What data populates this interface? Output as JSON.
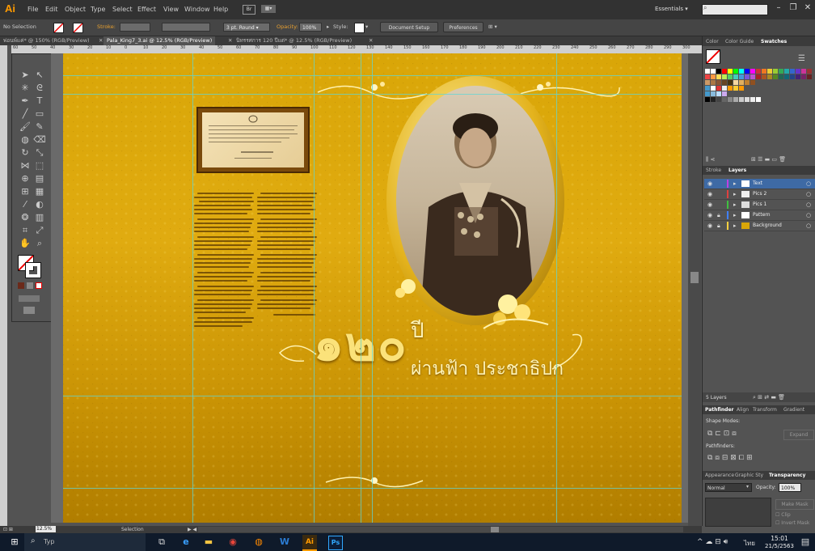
{
  "app": {
    "logo": "Ai",
    "workspace": "Essentials",
    "search_placeholder": ""
  },
  "menu": [
    "File",
    "Edit",
    "Object",
    "Type",
    "Select",
    "Effect",
    "View",
    "Window",
    "Help"
  ],
  "menu_badges": [
    "Br"
  ],
  "controls": {
    "selection": "No Selection",
    "stroke_label": "Stroke:",
    "stroke_value": "",
    "profile": "3 pt. Round",
    "opacity_label": "Opacity:",
    "opacity_value": "100%",
    "style_label": "Style:",
    "document_setup": "Document Setup",
    "preferences": "Preferences"
  },
  "tabs": [
    {
      "label": "พ่อนพ์แค่* @ 150% (RGB/Preview)",
      "active": false
    },
    {
      "label": "Pala_King7_3.ai @ 12.5% (RGB/Preview)",
      "active": true
    },
    {
      "label": "นิทรรศการ 120 ปีแต่* @ 12.5% (RGB/Preview)",
      "active": false
    }
  ],
  "ruler_ticks": [
    "60",
    "50",
    "40",
    "30",
    "20",
    "10",
    "0",
    "10",
    "20",
    "30",
    "40",
    "50",
    "60",
    "70",
    "80",
    "90",
    "100",
    "110",
    "120",
    "130",
    "140",
    "150",
    "160",
    "170",
    "180",
    "190",
    "200",
    "210",
    "220",
    "230",
    "240",
    "250",
    "260",
    "270",
    "280",
    "290",
    "300"
  ],
  "artwork": {
    "headline_numeral": "๑๒๐",
    "headline_year": "ปี",
    "headline_subtitle": "ผ่านฟ้า ประชาธิปก"
  },
  "right_panel": {
    "top_tabs": [
      "Color",
      "Color Guide",
      "Swatches"
    ],
    "layer_tabs": [
      "Stroke",
      "Layers"
    ],
    "layers": [
      {
        "name": "Text",
        "selected": true,
        "color": "#c040e0"
      },
      {
        "name": "Pics 2",
        "selected": false,
        "color": "#e04040"
      },
      {
        "name": "Pics 1",
        "selected": false,
        "color": "#40c040"
      },
      {
        "name": "Pattern",
        "selected": false,
        "color": "#4080ff"
      },
      {
        "name": "Background",
        "selected": false,
        "color": "#ffd040"
      }
    ],
    "layer_count": "5 Layers",
    "pathfinder_tabs": [
      "Pathfinder",
      "Align",
      "Transform",
      "Gradient"
    ],
    "shape_modes": "Shape Modes:",
    "pathfinders": "Pathfinders:",
    "expand": "Expand",
    "appearance_tabs": [
      "Appearance",
      "Graphic Sty",
      "Transparency"
    ],
    "blend_mode": "Normal",
    "opacity_label": "Opacity:",
    "opacity_value": "100%",
    "make_mask": "Make Mask",
    "clip": "Clip",
    "invert_mask": "Invert Mask"
  },
  "status": {
    "zoom": "12.5%",
    "tool": "Selection"
  },
  "taskbar": {
    "search": "Typ",
    "time": "15:01",
    "date": "21/5/2563",
    "lang": "ไทย"
  },
  "colors": {
    "accent": "#ff9a00",
    "gold": "#d9a608",
    "layer_selected": "#3e6aa5",
    "guide": "#5fd5d5"
  }
}
